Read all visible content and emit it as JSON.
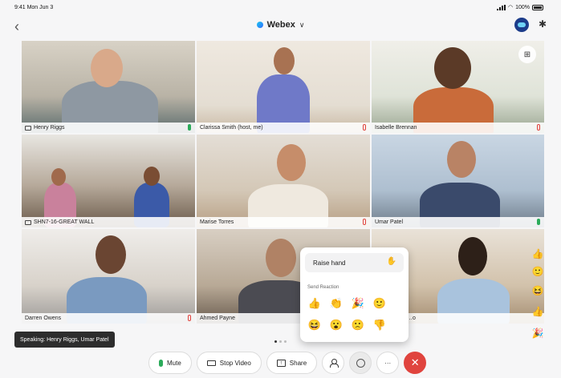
{
  "status_bar": {
    "time": "9:41 Mon Jun 3",
    "battery": "100%"
  },
  "header": {
    "app_title": "Webex",
    "back_glyph": "‹",
    "chevron_glyph": "∨",
    "bluetooth_glyph": "✱"
  },
  "layout_button": {
    "icon": "grid-layout-icon",
    "glyph": "⊞"
  },
  "participants": [
    {
      "name": "Henry Riggs",
      "mic": "on",
      "active_speaker": true,
      "shares_device": true
    },
    {
      "name": "Clarissa Smith (host, me)",
      "mic": "muted"
    },
    {
      "name": "Isabelle Brennan",
      "mic": "muted"
    },
    {
      "name": "SHN7-16-GREAT WALL",
      "mic": "none",
      "room_device": true
    },
    {
      "name": "Marise Torres",
      "mic": "muted"
    },
    {
      "name": "Umar Patel",
      "mic": "on",
      "active_speaker": true
    },
    {
      "name": "Darren Owens",
      "mic": "muted"
    },
    {
      "name": "Ahmed Payne",
      "mic": "muted"
    },
    {
      "name": "…o",
      "mic": "none"
    }
  ],
  "reaction_popup": {
    "raise_hand_label": "Raise hand",
    "raise_hand_glyph": "✋",
    "send_reaction_label": "Send Reaction",
    "reactions": [
      {
        "name": "thumbs-up",
        "glyph": "👍"
      },
      {
        "name": "clap",
        "glyph": "👏"
      },
      {
        "name": "celebrate",
        "glyph": "🎉"
      },
      {
        "name": "smile",
        "glyph": "🙂"
      },
      {
        "name": "laugh",
        "glyph": "😆"
      },
      {
        "name": "surprised",
        "glyph": "😮"
      },
      {
        "name": "sad",
        "glyph": "🙁"
      },
      {
        "name": "thumbs-down",
        "glyph": "👎"
      }
    ]
  },
  "floating_reactions": [
    "👍",
    "🙂",
    "😆",
    "👍",
    "🎉"
  ],
  "speaking_toast": "Speaking: Henry Riggs, Umar Patel",
  "controls": {
    "mute_label": "Mute",
    "stop_video_label": "Stop Video",
    "share_label": "Share",
    "more_glyph": "···",
    "end_glyph": "✕"
  },
  "colors": {
    "accent": "#4ec3ee",
    "end_call": "#e0443e",
    "mic_on": "#2bab5a"
  }
}
